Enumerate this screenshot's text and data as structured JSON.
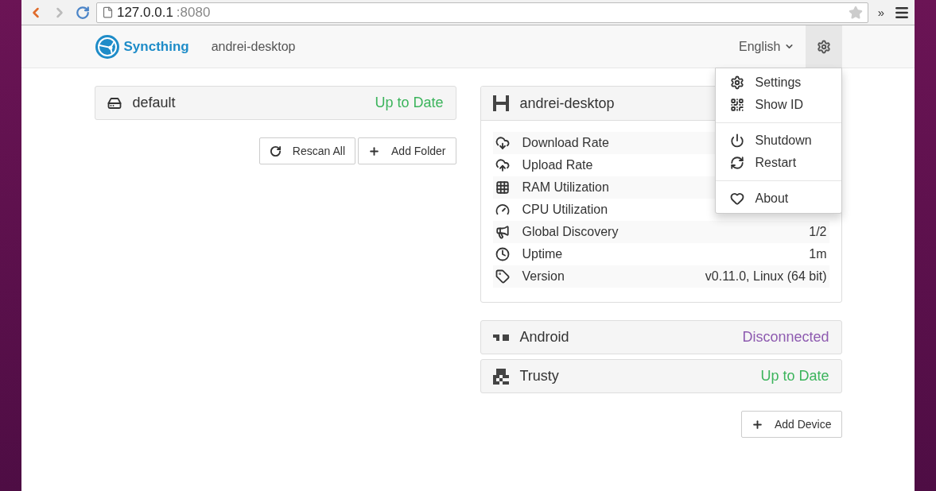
{
  "browser": {
    "url_host": "127.0.0.1",
    "url_port": ":8080",
    "overflow": "»"
  },
  "navbar": {
    "brand": "Syncthing",
    "device_name": "andrei-desktop",
    "language": "English"
  },
  "settings_menu": {
    "open": true,
    "groups": [
      {
        "items": [
          "Settings",
          "Show ID"
        ]
      },
      {
        "items": [
          "Shutdown",
          "Restart"
        ]
      },
      {
        "items": [
          "About"
        ]
      }
    ]
  },
  "folders": [
    {
      "name": "default",
      "status": "Up to Date",
      "color": "#3cb45c"
    }
  ],
  "folder_buttons": [
    "Rescan All",
    "Add Folder"
  ],
  "this_device": {
    "name": "andrei-desktop",
    "stats": [
      {
        "label": "Download Rate"
      },
      {
        "label": "Upload Rate"
      },
      {
        "label": "RAM Utilization"
      },
      {
        "label": "CPU Utilization"
      },
      {
        "label": "Global Discovery",
        "value": "1/2"
      },
      {
        "label": "Uptime",
        "value": "1m"
      },
      {
        "label": "Version",
        "value": "v0.11.0, Linux (64 bit)"
      }
    ]
  },
  "devices": [
    {
      "name": "Android",
      "status": "Disconnected",
      "color": "#8e5bb0"
    },
    {
      "name": "Trusty",
      "status": "Up to Date",
      "color": "#3cb45c"
    }
  ],
  "device_buttons": [
    "Add Device"
  ]
}
